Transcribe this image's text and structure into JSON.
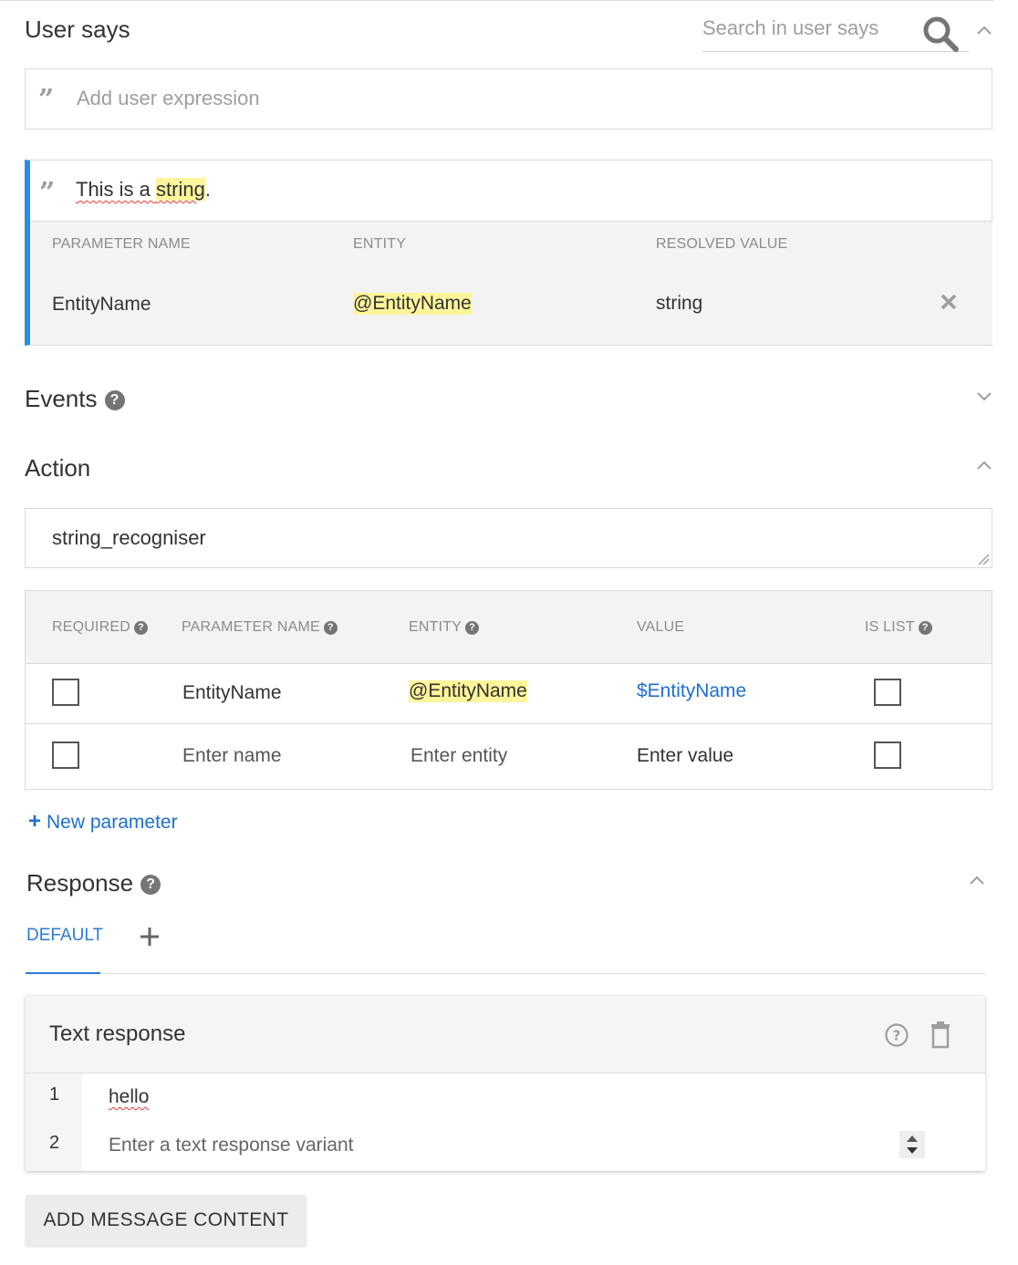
{
  "user_says": {
    "title": "User says",
    "search_placeholder": "Search in user says",
    "add_placeholder": "Add user expression",
    "expression": {
      "prefix": "This is a ",
      "highlighted": "string",
      "suffix": "."
    },
    "table": {
      "headers": [
        "PARAMETER NAME",
        "ENTITY",
        "RESOLVED VALUE"
      ],
      "row": {
        "parameter": "EntityName",
        "entity": "@EntityName",
        "resolved": "string"
      }
    }
  },
  "events": {
    "title": "Events"
  },
  "action": {
    "title": "Action",
    "value": "string_recogniser",
    "headers": {
      "required": "REQUIRED",
      "parameter": "PARAMETER NAME",
      "entity": "ENTITY",
      "value": "VALUE",
      "is_list": "IS LIST"
    },
    "rows": [
      {
        "name": "EntityName",
        "entity": "@EntityName",
        "value": "$EntityName"
      }
    ],
    "new_row": {
      "name_placeholder": "Enter name",
      "entity_placeholder": "Enter entity",
      "value_placeholder": "Enter value"
    },
    "new_parameter": "New parameter"
  },
  "response": {
    "title": "Response",
    "tab_default": "DEFAULT",
    "text_response": {
      "title": "Text response",
      "lines": [
        {
          "num": "1",
          "text": "hello"
        }
      ],
      "new_line_num": "2",
      "new_line_placeholder": "Enter a text response variant"
    },
    "add_button": "ADD MESSAGE CONTENT"
  },
  "colors": {
    "accent": "#2b7ad6",
    "highlight": "#fdf59a",
    "link": "#1e6fd0"
  }
}
